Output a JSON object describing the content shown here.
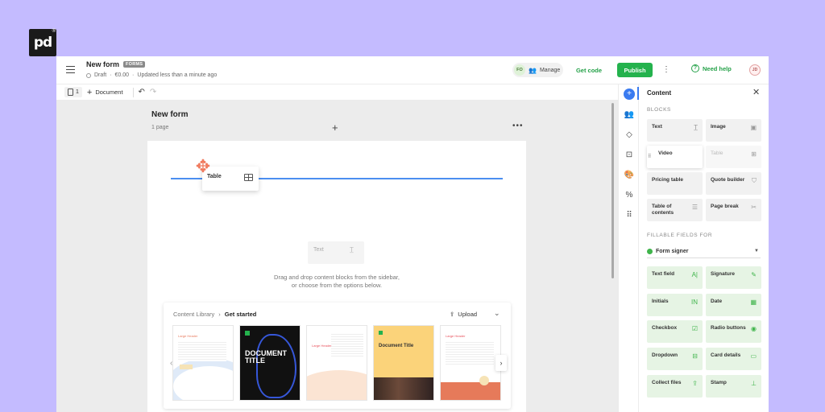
{
  "header": {
    "title": "New form",
    "badge": "FORMS",
    "status": "Draft",
    "price": "€0.00",
    "updated": "Updated less than a minute ago",
    "collaborator_initials": "FO",
    "manage_label": "Manage",
    "get_code_label": "Get code",
    "publish_label": "Publish",
    "help_label": "Need help",
    "user_initials": "JD"
  },
  "toolbar": {
    "page_count": "1",
    "add_label": "Document"
  },
  "canvas": {
    "title": "New form",
    "subtitle": "1 page",
    "drag_block_label": "Table",
    "ghost_block_label": "Text",
    "hint_line1": "Drag and drop content blocks from the sidebar,",
    "hint_line2": "or choose from the options below."
  },
  "library": {
    "crumb_root": "Content Library",
    "crumb_current": "Get started",
    "upload_label": "Upload",
    "thumbnails": [
      {
        "title": "Large Header"
      },
      {
        "title": "DOCUMENT TITLE"
      },
      {
        "title": "Large Header"
      },
      {
        "title": "Document Title"
      },
      {
        "title": "Large Header"
      }
    ]
  },
  "panel": {
    "title": "Content",
    "blocks_heading": "BLOCKS",
    "blocks": [
      {
        "label": "Text",
        "icon": "text-icon"
      },
      {
        "label": "Image",
        "icon": "image-icon"
      },
      {
        "label": "Video",
        "icon": "video-icon"
      },
      {
        "label": "Table",
        "icon": "table-icon"
      },
      {
        "label": "Pricing table",
        "icon": "pricing-table-icon"
      },
      {
        "label": "Quote builder",
        "icon": "quote-builder-icon"
      },
      {
        "label": "Table of contents",
        "icon": "list-icon"
      },
      {
        "label": "Page break",
        "icon": "scissors-icon"
      }
    ],
    "fields_heading": "FILLABLE FIELDS FOR",
    "signer": "Form signer",
    "fields": [
      {
        "label": "Text field",
        "icon": "text-field-icon"
      },
      {
        "label": "Signature",
        "icon": "pen-icon"
      },
      {
        "label": "Initials",
        "icon": "initials-icon"
      },
      {
        "label": "Date",
        "icon": "calendar-icon"
      },
      {
        "label": "Checkbox",
        "icon": "checkbox-icon"
      },
      {
        "label": "Radio buttons",
        "icon": "radio-icon"
      },
      {
        "label": "Dropdown",
        "icon": "dropdown-icon"
      },
      {
        "label": "Card details",
        "icon": "card-icon"
      },
      {
        "label": "Collect files",
        "icon": "upload-icon"
      },
      {
        "label": "Stamp",
        "icon": "stamp-icon"
      }
    ]
  },
  "colors": {
    "accent_green": "#24b24d",
    "accent_blue": "#3a7bf0",
    "background": "#c4bbff"
  }
}
